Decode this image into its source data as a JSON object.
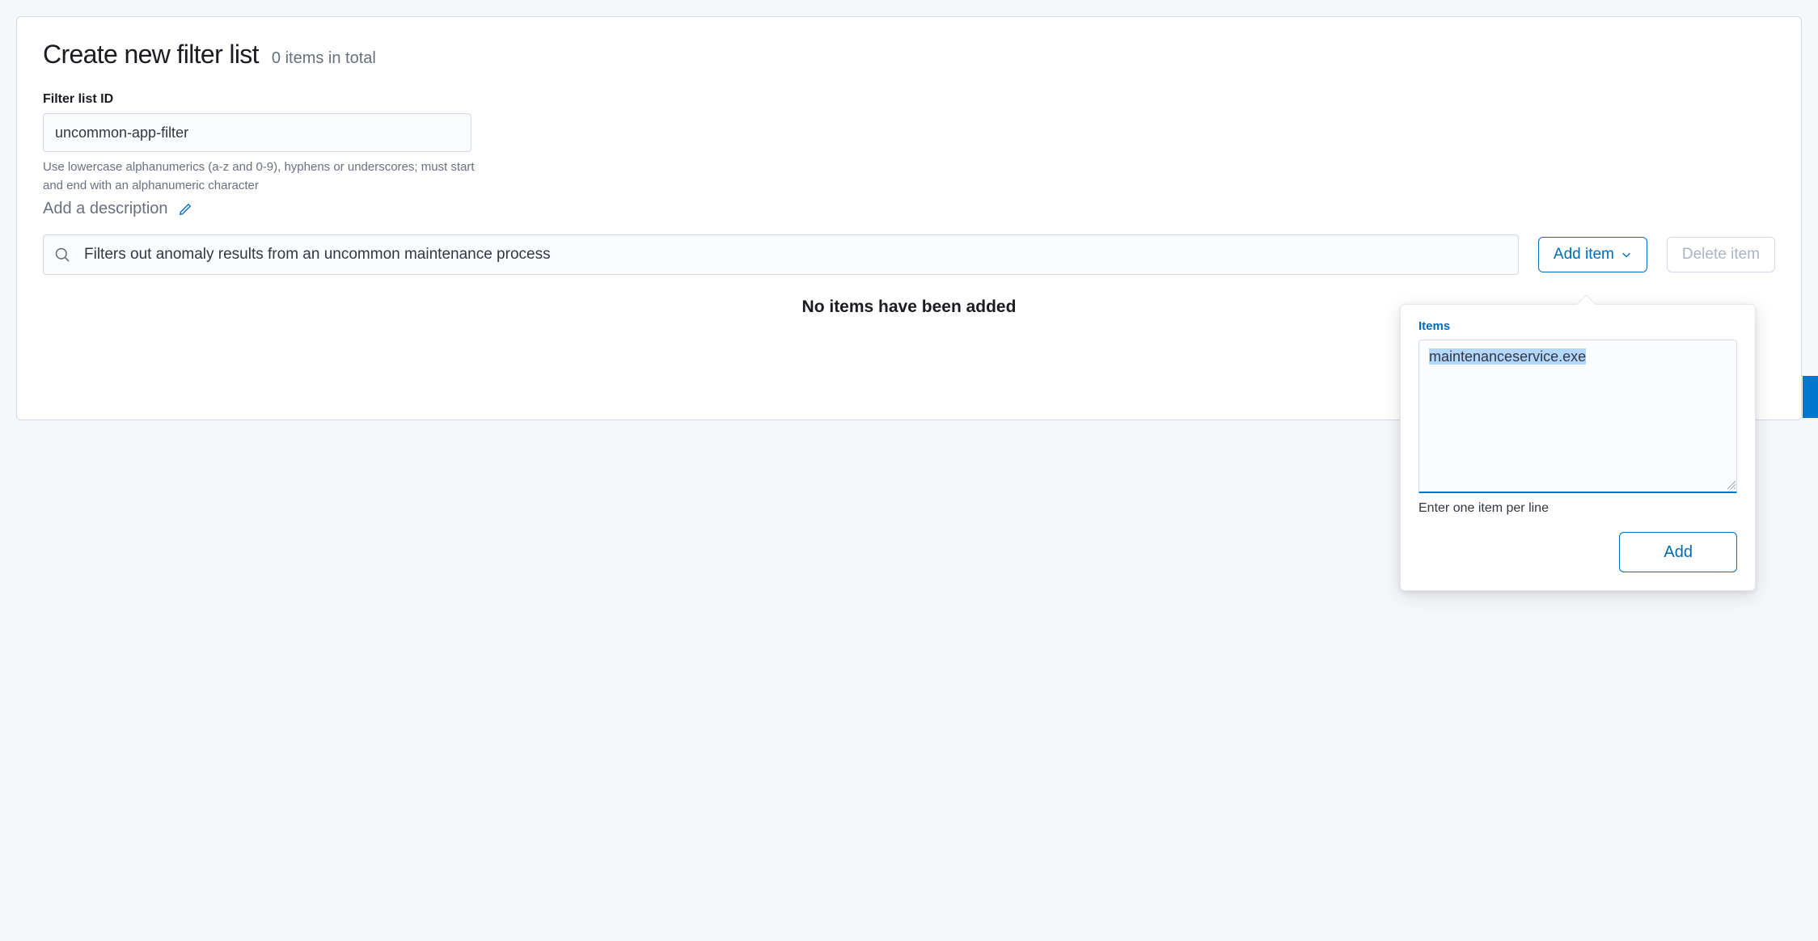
{
  "header": {
    "title": "Create new filter list",
    "count_text": "0 items in total"
  },
  "id_field": {
    "label": "Filter list ID",
    "value": "uncommon-app-filter",
    "help": "Use lowercase alphanumerics (a-z and 0-9), hyphens or underscores; must start and end with an alphanumeric character"
  },
  "description": {
    "placeholder": "Add a description"
  },
  "search": {
    "value": "Filters out anomaly results from an uncommon maintenance process"
  },
  "buttons": {
    "add_item": "Add item",
    "delete_item": "Delete item"
  },
  "empty_state": "No items have been added",
  "popover": {
    "label": "Items",
    "textarea_value": "maintenanceservice.exe",
    "help": "Enter one item per line",
    "add_button": "Add"
  }
}
